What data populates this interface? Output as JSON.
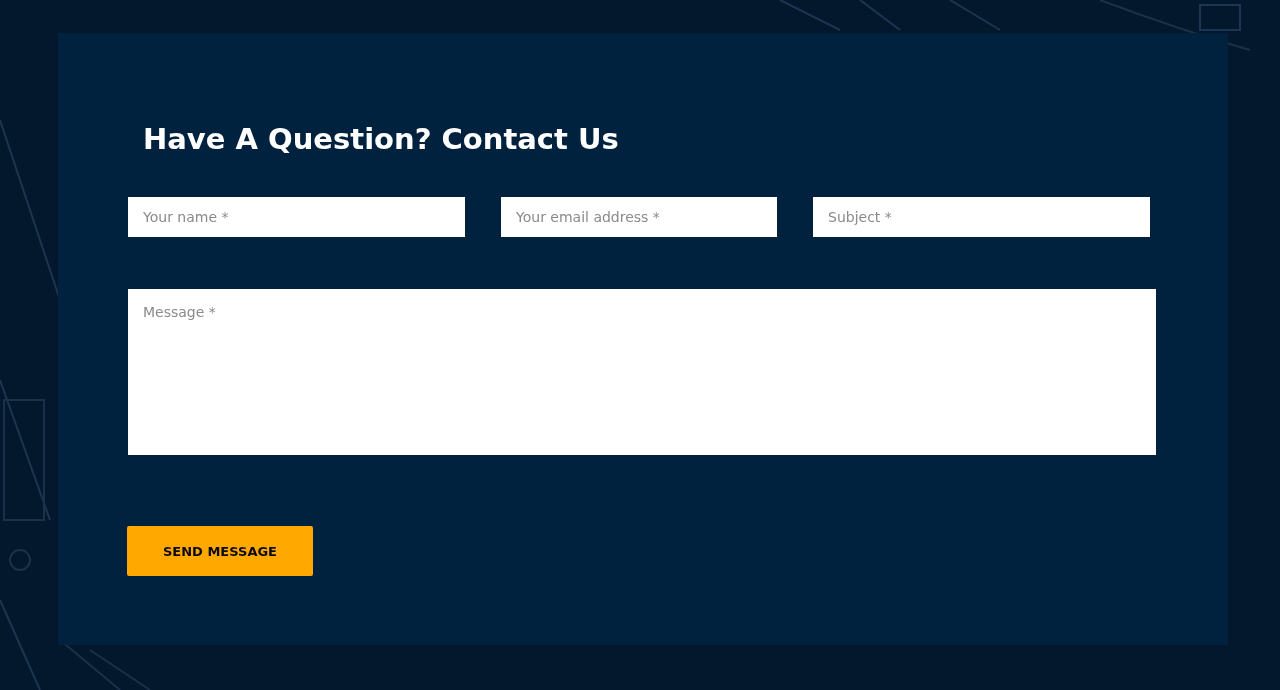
{
  "heading": "Have A Question? Contact Us",
  "fields": [
    {
      "placeholder": "Your name *"
    },
    {
      "placeholder": "Your email address *"
    },
    {
      "placeholder": "Subject *"
    }
  ],
  "message": {
    "placeholder": "Message *"
  },
  "submit": {
    "label": "SEND MESSAGE"
  }
}
